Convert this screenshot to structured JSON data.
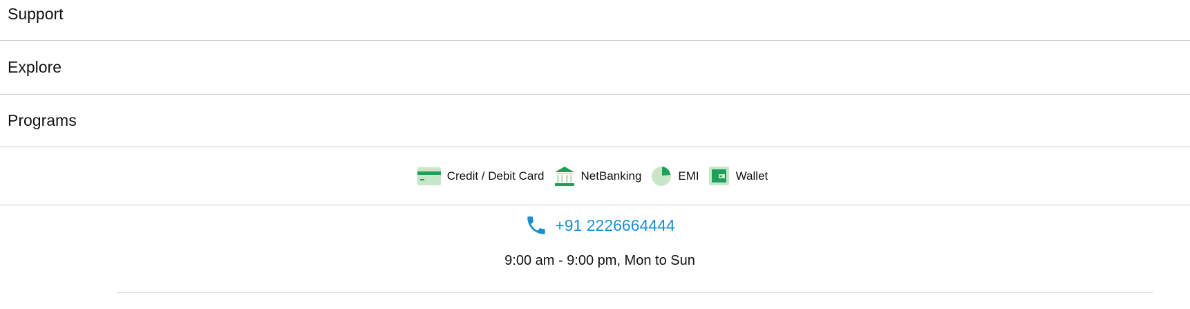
{
  "accordion": {
    "items": [
      {
        "label": "Support"
      },
      {
        "label": "Explore"
      },
      {
        "label": "Programs"
      }
    ]
  },
  "payments": {
    "methods": [
      {
        "label": "Credit / Debit Card",
        "icon": "credit-card-icon"
      },
      {
        "label": "NetBanking",
        "icon": "bank-icon"
      },
      {
        "label": "EMI",
        "icon": "pie-chart-icon"
      },
      {
        "label": "Wallet",
        "icon": "wallet-icon"
      }
    ],
    "colors": {
      "dark_green": "#1ea05a",
      "light_green": "#c7e7c7"
    }
  },
  "contact": {
    "phone": "+91 2226664444",
    "hours": "9:00 am - 9:00 pm, Mon to Sun",
    "link_color": "#1b8fd0"
  }
}
